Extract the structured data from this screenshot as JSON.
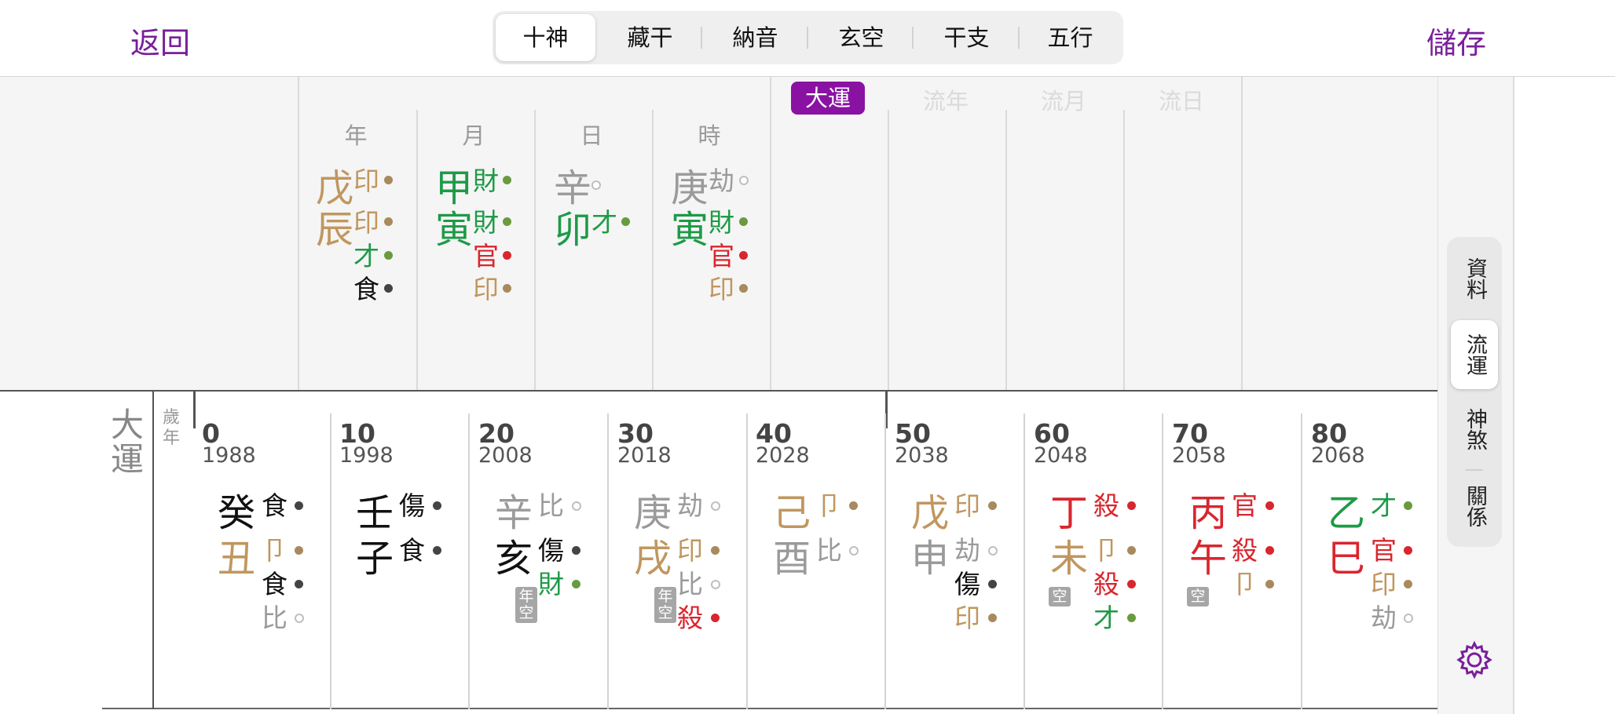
{
  "header": {
    "back_label": "返回",
    "save_label": "儲存",
    "tabs": [
      "十神",
      "藏干",
      "納音",
      "玄空",
      "干支",
      "五行"
    ],
    "selected_tab": "十神"
  },
  "colors": {
    "accent": "#8a12a3",
    "earth": "#c0975f",
    "wood": "#1e9a47",
    "fire": "#d9262e",
    "water": "#111111",
    "metal": "#9a9a9a"
  },
  "pillars": {
    "headers": [
      "年",
      "月",
      "日",
      "時"
    ],
    "luck_headers": [
      "大運",
      "流年",
      "流月",
      "流日"
    ],
    "year": {
      "stem": "戊",
      "branch": "辰",
      "gods": [
        "印",
        "印",
        "才",
        "食"
      ]
    },
    "month": {
      "stem": "甲",
      "branch": "寅",
      "gods": [
        "財",
        "財",
        "官",
        "印"
      ]
    },
    "day": {
      "stem": "辛",
      "branch": "卯",
      "gods": [
        "才"
      ]
    },
    "hour": {
      "stem": "庚",
      "branch": "寅",
      "gods": [
        "劫",
        "財",
        "官",
        "印"
      ]
    }
  },
  "dayun": {
    "label": "大運",
    "age_year_label": "歲年",
    "kong_label": "年空",
    "kong_short": "空",
    "periods": [
      {
        "age": "0",
        "year": "1988",
        "stem": "癸",
        "branch": "丑",
        "gods": [
          "食",
          "卩",
          "食",
          "比"
        ]
      },
      {
        "age": "10",
        "year": "1998",
        "stem": "壬",
        "branch": "子",
        "gods": [
          "傷",
          "食"
        ]
      },
      {
        "age": "20",
        "year": "2008",
        "stem": "辛",
        "branch": "亥",
        "gods": [
          "比",
          "傷",
          "財"
        ]
      },
      {
        "age": "30",
        "year": "2018",
        "stem": "庚",
        "branch": "戌",
        "gods": [
          "劫",
          "印",
          "比",
          "殺"
        ]
      },
      {
        "age": "40",
        "year": "2028",
        "stem": "己",
        "branch": "酉",
        "gods": [
          "卩",
          "比"
        ]
      },
      {
        "age": "50",
        "year": "2038",
        "stem": "戊",
        "branch": "申",
        "gods": [
          "印",
          "劫",
          "傷",
          "印"
        ]
      },
      {
        "age": "60",
        "year": "2048",
        "stem": "丁",
        "branch": "未",
        "gods": [
          "殺",
          "卩",
          "殺",
          "才"
        ]
      },
      {
        "age": "70",
        "year": "2058",
        "stem": "丙",
        "branch": "午",
        "gods": [
          "官",
          "殺",
          "卩"
        ]
      },
      {
        "age": "80",
        "year": "2068",
        "stem": "乙",
        "branch": "巳",
        "gods": [
          "才",
          "官",
          "印",
          "劫"
        ]
      }
    ]
  },
  "sidebar": {
    "items": [
      "資料",
      "流運",
      "神煞",
      "關係"
    ],
    "selected": "流運",
    "settings_icon": "gear-icon"
  }
}
